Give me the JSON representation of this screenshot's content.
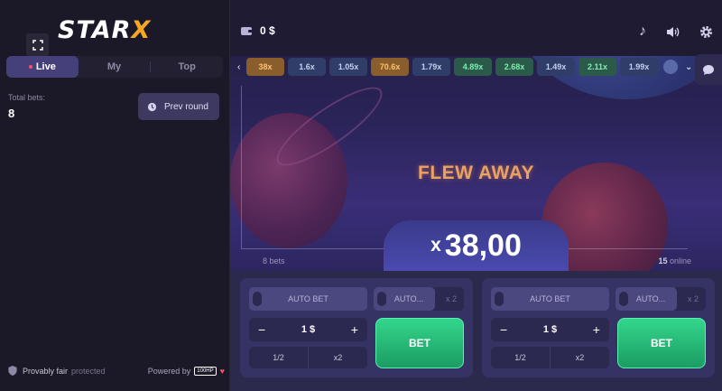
{
  "brand": {
    "logo_main": "STAR",
    "logo_x": "X"
  },
  "sidebar": {
    "tabs": [
      {
        "label": "Live"
      },
      {
        "label": "My"
      },
      {
        "label": "Top"
      }
    ],
    "total_bets_label": "Total bets:",
    "total_bets_value": "8",
    "prev_round_label": "Prev round",
    "footer_text": "Provably fair",
    "footer_status": "protected",
    "powered_by": "Powered by",
    "powered_badge": "100HP"
  },
  "header": {
    "balance": "0 $"
  },
  "history": [
    {
      "value": "38x",
      "color": "orange"
    },
    {
      "value": "1.6x",
      "color": "blue"
    },
    {
      "value": "1.05x",
      "color": "blue"
    },
    {
      "value": "70.6x",
      "color": "orange"
    },
    {
      "value": "1.79x",
      "color": "blue"
    },
    {
      "value": "4.89x",
      "color": "green"
    },
    {
      "value": "2.68x",
      "color": "green"
    },
    {
      "value": "1.49x",
      "color": "blue"
    },
    {
      "value": "2.11x",
      "color": "green"
    },
    {
      "value": "1.99x",
      "color": "blue"
    }
  ],
  "game": {
    "status": "FLEW AWAY",
    "multiplier_prefix": "x",
    "multiplier": "38,00",
    "bets_count": "8",
    "bets_label": "bets",
    "online_count": "15",
    "online_label": "online"
  },
  "panels": [
    {
      "autobet": "AUTO BET",
      "autocash": "AUTO...",
      "autocash_mult": "x 2",
      "amount": "1 $",
      "minus": "−",
      "plus": "+",
      "half": "1/2",
      "double": "x2",
      "bet": "BET"
    },
    {
      "autobet": "AUTO BET",
      "autocash": "AUTO...",
      "autocash_mult": "x 2",
      "amount": "1 $",
      "minus": "−",
      "plus": "+",
      "half": "1/2",
      "double": "x2",
      "bet": "BET"
    }
  ]
}
